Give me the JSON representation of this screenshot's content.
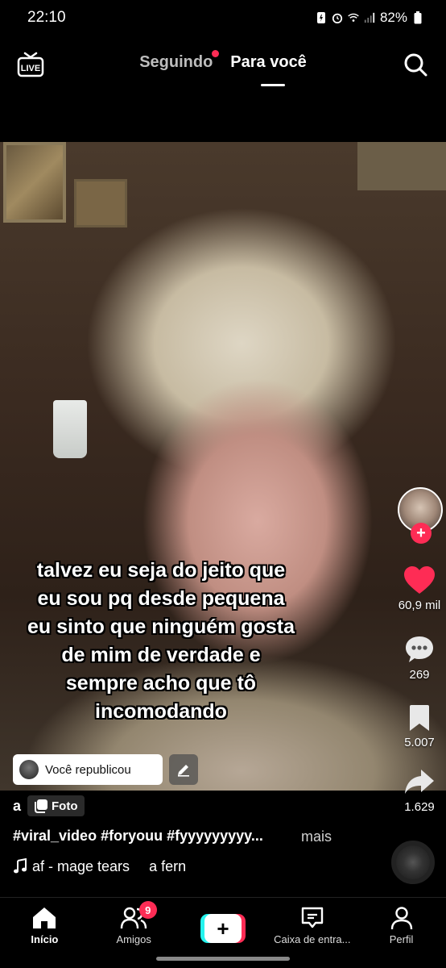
{
  "status_bar": {
    "time": "22:10",
    "battery": "82%"
  },
  "top_nav": {
    "live_label": "LIVE",
    "tabs": [
      {
        "label": "Seguindo",
        "has_dot": true
      },
      {
        "label": "Para você",
        "active": true
      }
    ]
  },
  "video": {
    "caption_lines": [
      "talvez eu seja do jeito que",
      "eu sou pq desde pequena",
      "eu sinto que ninguém gosta",
      "de mim de verdade e",
      "sempre acho que tô",
      "incomodando"
    ],
    "repost_label": "Você republicou"
  },
  "rail": {
    "likes": "60,9 mil",
    "comments": "269",
    "saves": "5.007",
    "shares": "1.629"
  },
  "info": {
    "author": "a",
    "photo_label": "Foto",
    "hashtags": "#viral_video #foryouu #fyyyyyyyyy...",
    "more": "mais",
    "music_title": "af - mage tears",
    "music_author": "a fern"
  },
  "bottom_nav": {
    "items": [
      {
        "label": "Início",
        "icon": "home-icon"
      },
      {
        "label": "Amigos",
        "icon": "friends-icon",
        "badge": "9"
      },
      {
        "label": "",
        "icon": "plus-icon"
      },
      {
        "label": "Caixa de entra...",
        "icon": "inbox-icon"
      },
      {
        "label": "Perfil",
        "icon": "profile-icon"
      }
    ]
  },
  "colors": {
    "accent": "#fe2c55",
    "cyan": "#25f4ee",
    "background": "#000000"
  }
}
